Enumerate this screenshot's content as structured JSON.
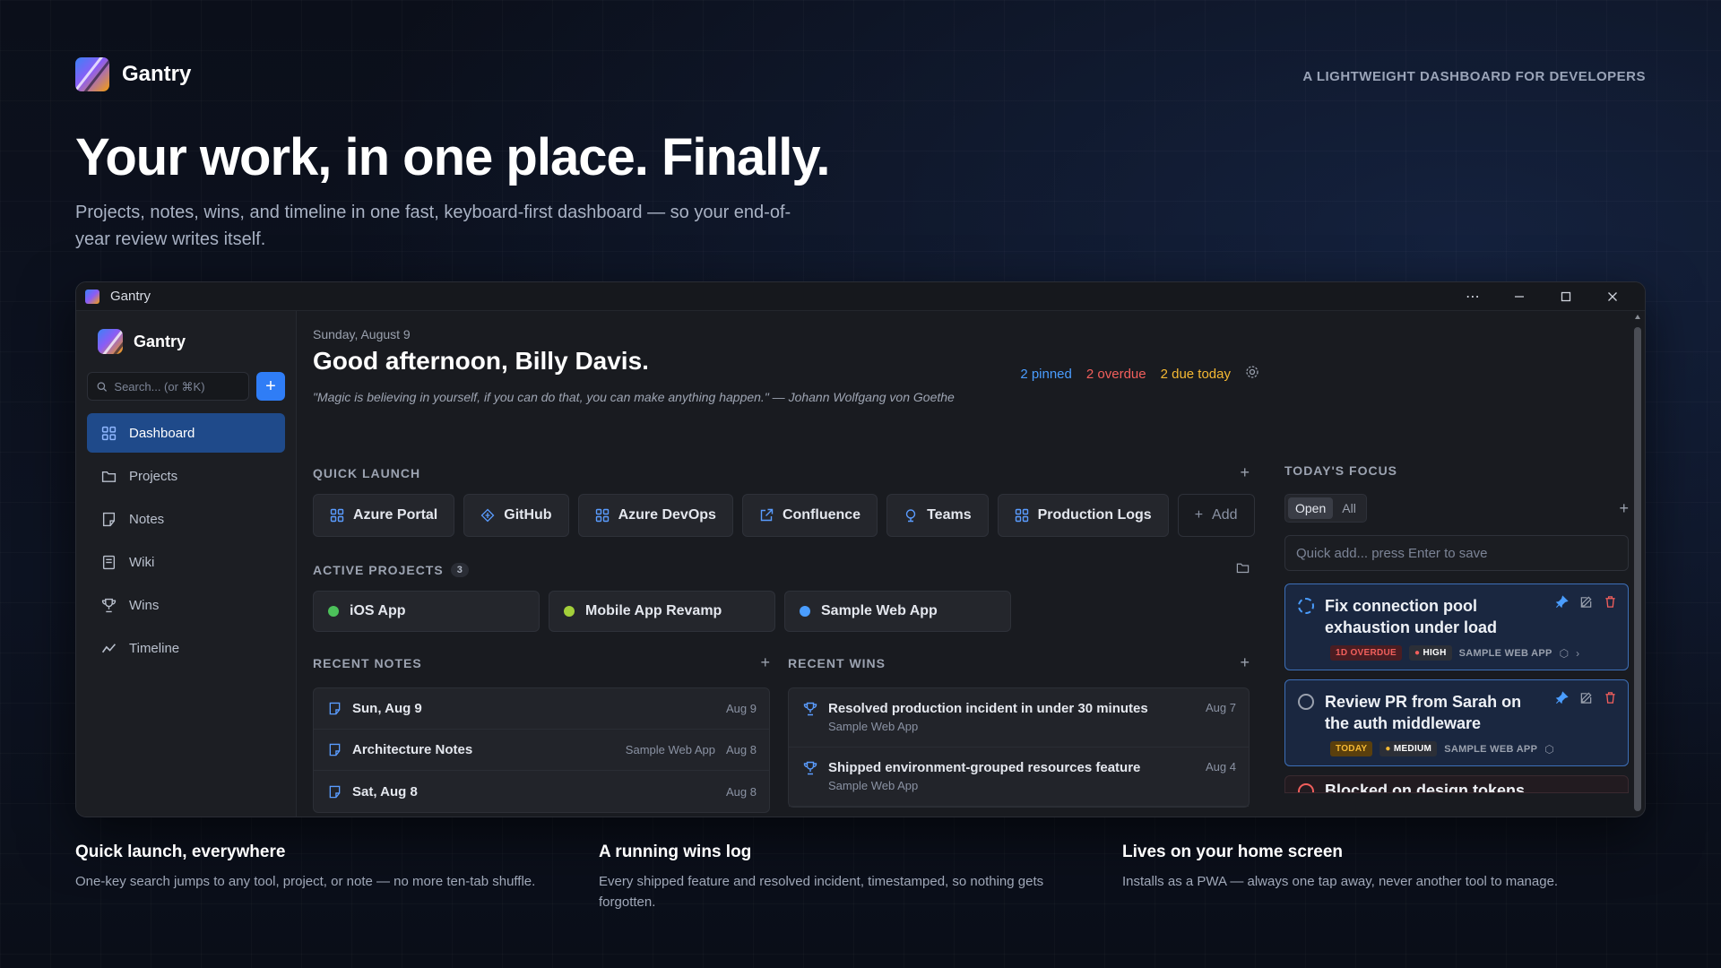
{
  "header": {
    "brand": "Gantry",
    "tagline": "A LIGHTWEIGHT DASHBOARD FOR DEVELOPERS",
    "hero_title": "Your work, in one place. Finally.",
    "hero_subtitle": "Projects, notes, wins, and timeline in one fast, keyboard-first dashboard — so your end-of-year review writes itself."
  },
  "window": {
    "title": "Gantry",
    "controls": [
      "more-icon",
      "minimize-icon",
      "maximize-icon",
      "close-icon"
    ]
  },
  "sidebar": {
    "brand": "Gantry",
    "search_placeholder": "Search... (or ⌘K)",
    "items": [
      {
        "label": "Dashboard",
        "icon": "dashboard-icon",
        "active": true
      },
      {
        "label": "Projects",
        "icon": "folder-icon",
        "active": false
      },
      {
        "label": "Notes",
        "icon": "note-icon",
        "active": false
      },
      {
        "label": "Wiki",
        "icon": "book-icon",
        "active": false
      },
      {
        "label": "Wins",
        "icon": "trophy-icon",
        "active": false
      },
      {
        "label": "Timeline",
        "icon": "chart-line-icon",
        "active": false
      }
    ]
  },
  "main": {
    "date": "Sunday, August 9",
    "greeting": "Good afternoon, Billy Davis.",
    "quote": "\"Magic is believing in yourself, if you can do that, you can make anything happen.\" — Johann Wolfgang von Goethe",
    "status": {
      "pinned": "2 pinned",
      "overdue": "2 overdue",
      "due_today": "2 due today"
    },
    "quick_launch": {
      "label": "QUICK LAUNCH",
      "items": [
        {
          "label": "Azure Portal",
          "icon": "grid-icon"
        },
        {
          "label": "GitHub",
          "icon": "diamond-icon"
        },
        {
          "label": "Azure DevOps",
          "icon": "grid-icon"
        },
        {
          "label": "Confluence",
          "icon": "external-link-icon"
        },
        {
          "label": "Teams",
          "icon": "globe-icon"
        },
        {
          "label": "Production Logs",
          "icon": "grid-icon"
        }
      ],
      "add_label": "Add"
    },
    "active_projects": {
      "label": "ACTIVE PROJECTS",
      "count": "3",
      "items": [
        {
          "label": "iOS App",
          "color": "#4cc15a"
        },
        {
          "label": "Mobile App Revamp",
          "color": "#a3cf3a"
        },
        {
          "label": "Sample Web App",
          "color": "#4a9dff"
        }
      ]
    },
    "recent_notes": {
      "label": "RECENT NOTES",
      "items": [
        {
          "title": "Sun, Aug 9",
          "project": "",
          "date": "Aug 9"
        },
        {
          "title": "Architecture Notes",
          "project": "Sample Web App",
          "date": "Aug 8"
        },
        {
          "title": "Sat, Aug 8",
          "project": "",
          "date": "Aug 8"
        }
      ]
    },
    "recent_wins": {
      "label": "RECENT WINS",
      "items": [
        {
          "title": "Resolved production incident in under 30 minutes",
          "project": "Sample Web App",
          "date": "Aug 7"
        },
        {
          "title": "Shipped environment-grouped resources feature",
          "project": "Sample Web App",
          "date": "Aug 4"
        }
      ]
    }
  },
  "focus": {
    "label": "TODAY'S FOCUS",
    "filter_open": "Open",
    "filter_all": "All",
    "quick_add_placeholder": "Quick add... press Enter to save",
    "tasks": [
      {
        "title": "Fix connection pool exhaustion under load",
        "status_tag": "1D OVERDUE",
        "priority": "HIGH",
        "project": "SAMPLE WEB APP"
      },
      {
        "title": "Review PR from Sarah on the auth middleware",
        "status_tag": "TODAY",
        "priority": "MEDIUM",
        "project": "SAMPLE WEB APP"
      },
      {
        "title": "Blocked on design tokens"
      }
    ]
  },
  "features": [
    {
      "title": "Quick launch, everywhere",
      "text": "One-key search jumps to any tool, project, or note — no more ten-tab shuffle."
    },
    {
      "title": "A running wins log",
      "text": "Every shipped feature and resolved incident, timestamped, so nothing gets forgotten."
    },
    {
      "title": "Lives on your home screen",
      "text": "Installs as a PWA — always one tap away, never another tool to manage."
    }
  ]
}
